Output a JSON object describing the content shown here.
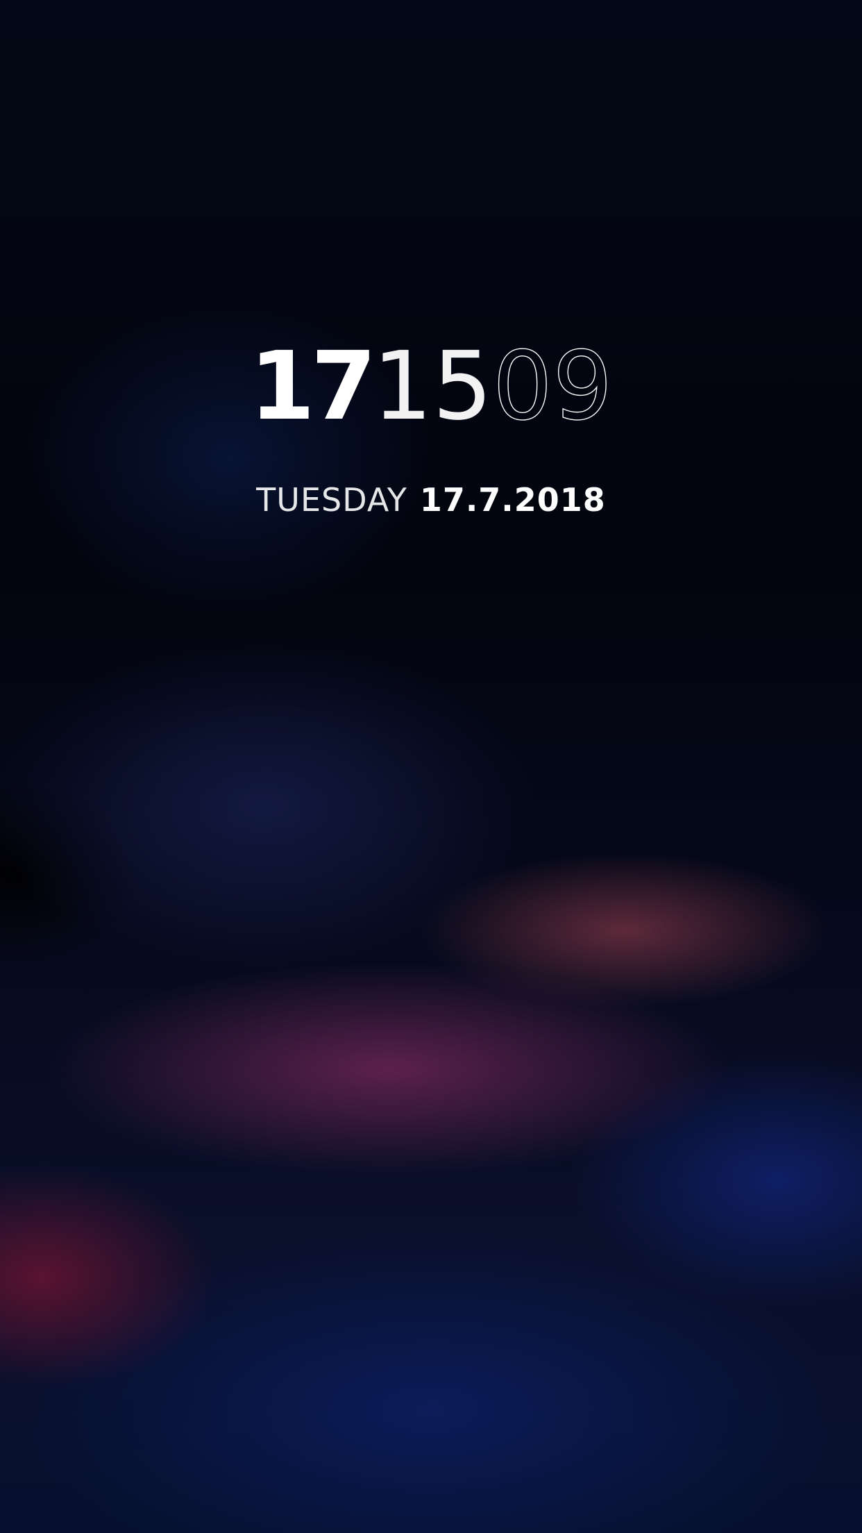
{
  "lockscreen": {
    "clock": {
      "hours": "17",
      "minutes": "15",
      "seconds": "09"
    },
    "date": {
      "weekday": "TUESDAY",
      "full_date": "17.7.2018"
    }
  },
  "colors": {
    "text": "#ffffff",
    "background_dark": "#02040d",
    "accent_blue": "#10247a",
    "accent_magenta": "#782a5a",
    "accent_red": "#6e1432"
  }
}
